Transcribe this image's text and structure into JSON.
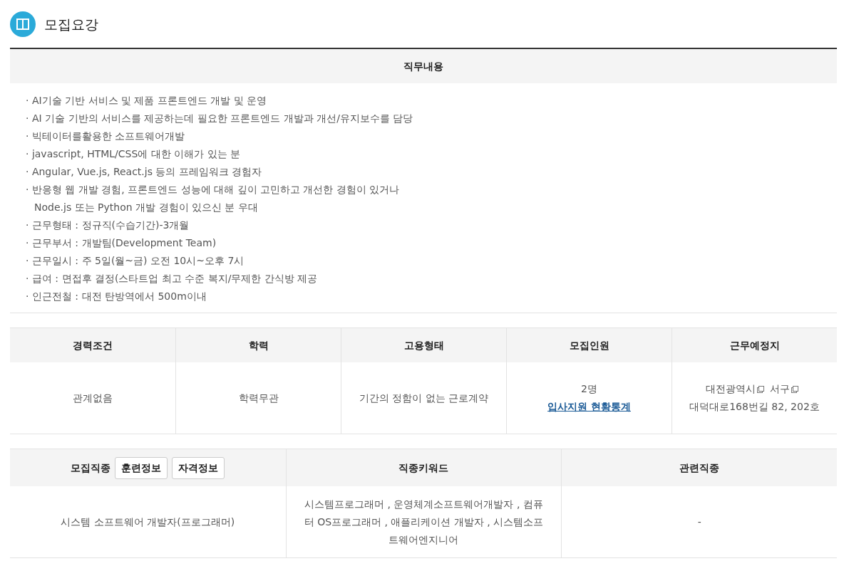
{
  "section_title": "모집요강",
  "job_content": {
    "heading": "직무내용",
    "items": [
      {
        "kind": "bullet",
        "text": "· AI기술 기반 서비스 및 제품 프론트엔드 개발 및 운영"
      },
      {
        "kind": "bullet",
        "text": "· AI 기술 기반의 서비스를 제공하는데 필요한 프론트엔드 개발과 개선/유지보수를 담당"
      },
      {
        "kind": "bullet",
        "text": "· 빅테이터를활용한 소프트웨어개발"
      },
      {
        "kind": "bullet",
        "text": "· javascript, HTML/CSS에 대한 이해가 있는 분"
      },
      {
        "kind": "bullet",
        "text": "· Angular, Vue.js, React.js 등의 프레임워크 경험자"
      },
      {
        "kind": "bullet",
        "text": "· 반응형 웹 개발 경험, 프론트엔드 성능에 대해 깊이 고민하고 개선한 경험이 있거나"
      },
      {
        "kind": "continuation",
        "text": "Node.js 또는 Python 개발 경험이 있으신 분 우대"
      },
      {
        "kind": "bullet",
        "text": "· 근무형태 : 정규직(수습기간)-3개월"
      },
      {
        "kind": "bullet",
        "text": "· 근무부서 : 개발팀(Development Team)"
      },
      {
        "kind": "bullet",
        "text": "· 근무일시 : 주 5일(월~금) 오전 10시~오후 7시"
      },
      {
        "kind": "bullet",
        "text": "· 급여 : 면접후 결정(스타트업 최고 수준 복지/무제한 간식방 제공"
      },
      {
        "kind": "bullet",
        "text": "· 인근전철 : 대전 탄방역에서 500m이내"
      }
    ]
  },
  "conditions": {
    "columns": [
      "경력조건",
      "학력",
      "고용형태",
      "모집인원",
      "근무예정지"
    ],
    "experience": "관계없음",
    "education": "학력무관",
    "employment_type": "기간의 정함이 없는 근로계약",
    "headcount": "2명",
    "headcount_link": "입사지원 현황통계",
    "location_parts": [
      {
        "text": "대전광역시",
        "link_icon": true
      },
      {
        "text": "서구",
        "link_icon": true
      },
      {
        "text": "대덕대로168번길 82, 202호",
        "link_icon": false
      }
    ]
  },
  "occupation": {
    "columns": [
      {
        "label": "모집직종",
        "buttons": [
          "훈련정보",
          "자격정보"
        ]
      },
      {
        "label": "직종키워드"
      },
      {
        "label": "관련직종"
      }
    ],
    "cells": [
      "시스템 소프트웨어 개발자(프로그래머)",
      "시스템프로그래머 , 운영체계소프트웨어개발자 , 컴퓨터 OS프로그래머 , 애플리케이션 개발자 , 시스템소프트웨어엔지니어",
      "-"
    ]
  }
}
